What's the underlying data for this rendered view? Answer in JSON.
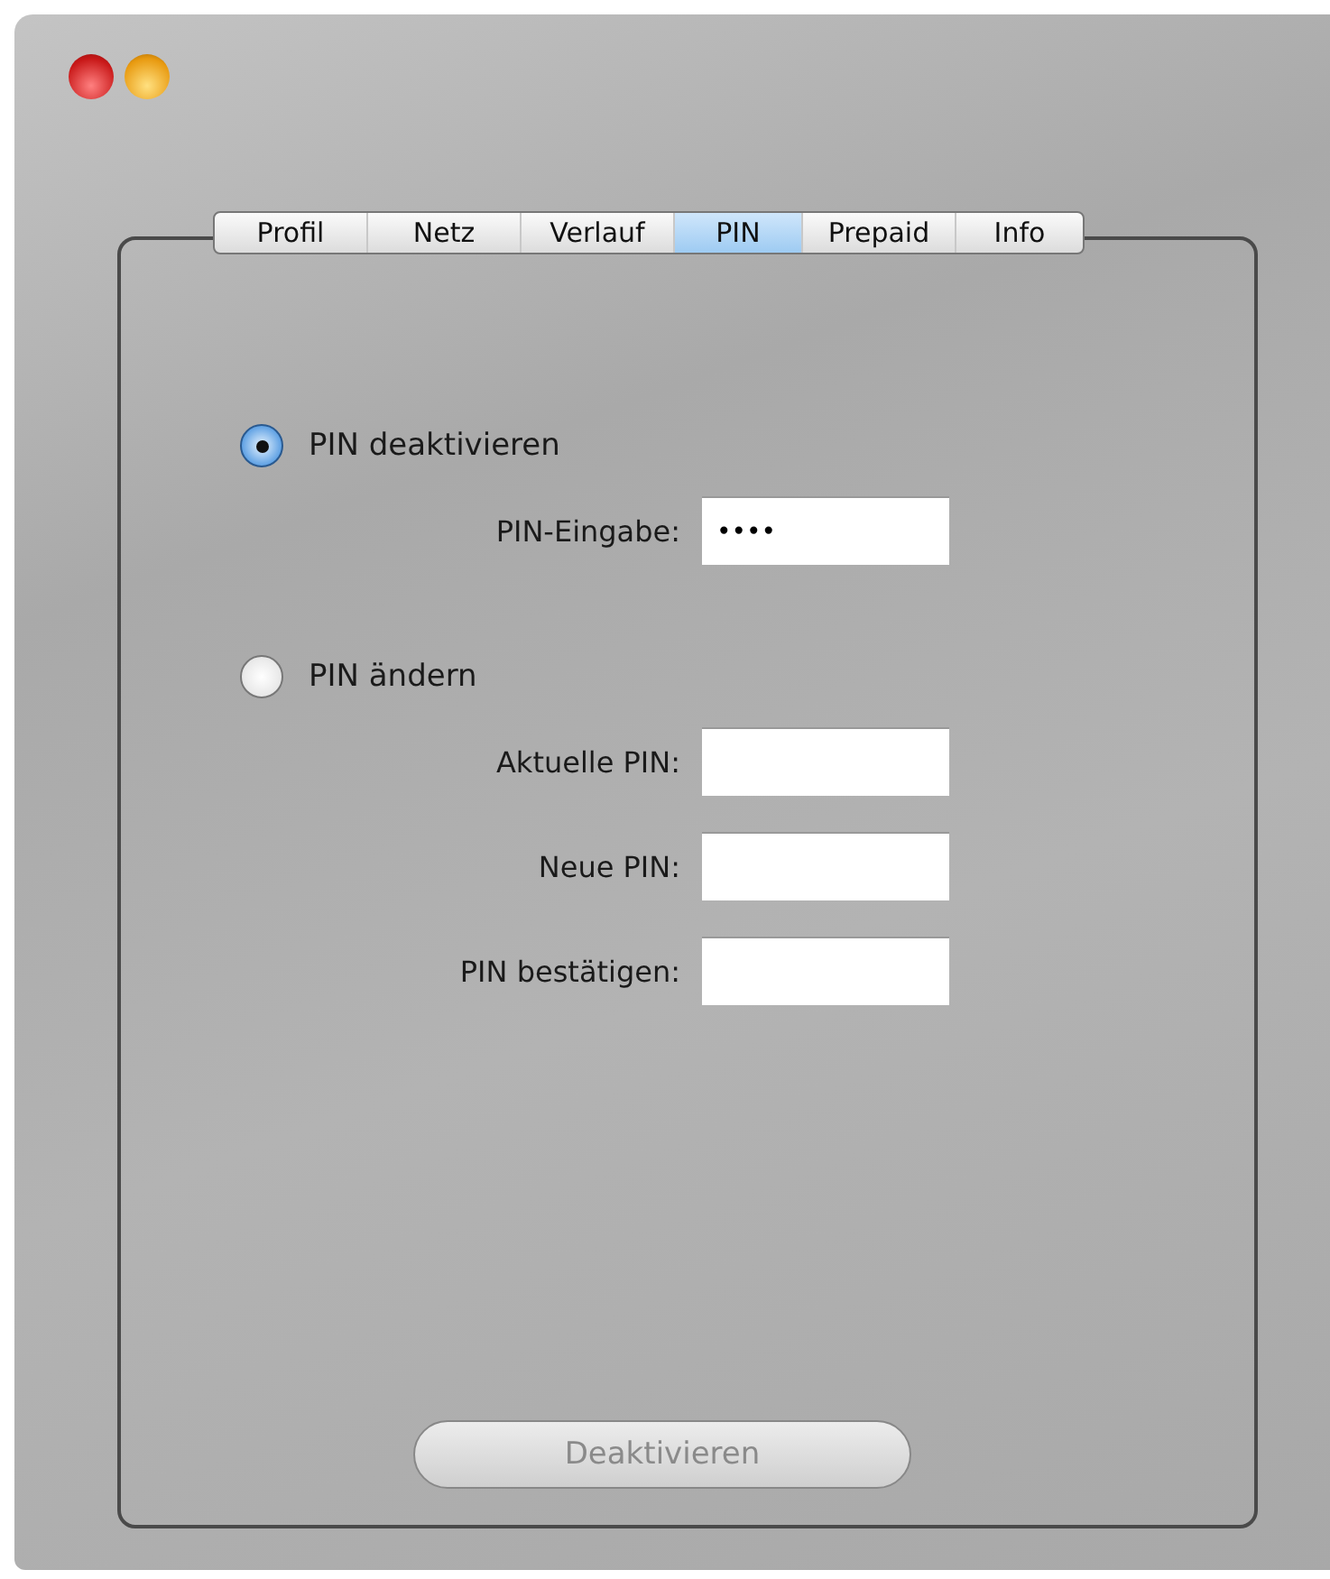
{
  "tabs": [
    {
      "label": "Profil",
      "selected": false
    },
    {
      "label": "Netz",
      "selected": false
    },
    {
      "label": "Verlauf",
      "selected": false
    },
    {
      "label": "PIN",
      "selected": true
    },
    {
      "label": "Prepaid",
      "selected": false
    },
    {
      "label": "Info",
      "selected": false
    }
  ],
  "options": [
    {
      "label": "PIN deaktivieren",
      "selected": true,
      "fields": [
        {
          "label": "PIN-Eingabe:",
          "value": "••••"
        }
      ]
    },
    {
      "label": "PIN ändern",
      "selected": false,
      "fields": [
        {
          "label": "Aktuelle PIN:"
        },
        {
          "label": "Neue PIN:"
        },
        {
          "label": "PIN bestätigen:"
        }
      ]
    }
  ],
  "button": {
    "label": "Deaktivieren",
    "disabled": true
  }
}
